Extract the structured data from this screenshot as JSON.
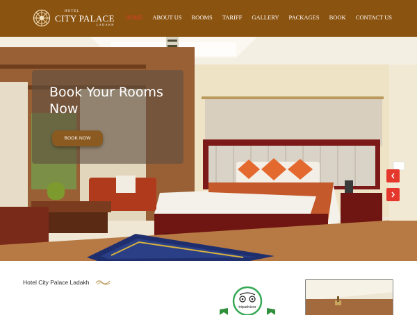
{
  "brand": {
    "small_text": "HOTEL",
    "name": "CITY PALACE",
    "sub_text": "LADAKH"
  },
  "nav": {
    "items": [
      {
        "label": "HOME",
        "active": true
      },
      {
        "label": "ABOUT US",
        "active": false
      },
      {
        "label": "ROOMS",
        "active": false
      },
      {
        "label": "TARIFF",
        "active": false
      },
      {
        "label": "GALLERY",
        "active": false
      },
      {
        "label": "PACKAGES",
        "active": false
      },
      {
        "label": "BOOK",
        "active": false
      },
      {
        "label": "CONTACT US",
        "active": false
      }
    ]
  },
  "hero": {
    "title": "Book Your Rooms Now",
    "button_label": "BOOK NOW",
    "prev_icon": "chevron-left-icon",
    "next_icon": "chevron-right-icon"
  },
  "about": {
    "title": "Hotel City Palace Ladakh"
  },
  "badge": {
    "label": "tripadvisor"
  },
  "colors": {
    "header_bg": "#8b5310",
    "nav_active": "#e53d2b",
    "accent_red": "#e4382c",
    "button_bg": "#8b5a20"
  }
}
